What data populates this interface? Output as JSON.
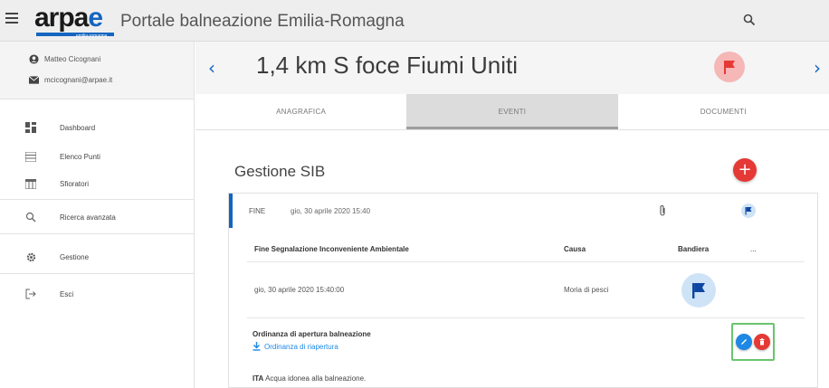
{
  "header": {
    "logo_text": "arpae",
    "logo_sub": "emilia-romagna",
    "portal_title": "Portale balneazione Emilia-Romagna",
    "search_icon": "search-icon",
    "menu_icon": "hamburger-icon"
  },
  "user": {
    "name": "Matteo Cicognani",
    "email": "mcicognani@arpae.it"
  },
  "sidebar": {
    "items": [
      {
        "label": "Dashboard",
        "icon": "dashboard-icon"
      },
      {
        "label": "Elenco Punti",
        "icon": "list-icon"
      },
      {
        "label": "Sfioratori",
        "icon": "calendar-icon"
      },
      {
        "label": "Ricerca avanzata",
        "icon": "search-icon"
      },
      {
        "label": "Gestione",
        "icon": "gear-icon"
      },
      {
        "label": "Esci",
        "icon": "logout-icon"
      }
    ]
  },
  "point": {
    "title": "1,4 km S foce Fiumi Uniti",
    "flag_color": "#e53935"
  },
  "tabs": [
    {
      "label": "ANAGRAFICA",
      "active": false
    },
    {
      "label": "EVENTI",
      "active": true
    },
    {
      "label": "DOCUMENTI",
      "active": false
    }
  ],
  "section": {
    "title": "Gestione SIB",
    "add_label": "+"
  },
  "event": {
    "status": "FINE",
    "datetime": "gio, 30 aprile 2020 15:40",
    "table": {
      "headers": [
        "Fine Segnalazione Inconveniente Ambientale",
        "Causa",
        "Bandiera",
        "..."
      ],
      "row": {
        "date": "gio, 30 aprile 2020 15:40:00",
        "cause": "Moria di pesci"
      }
    },
    "ordinance": {
      "title": "Ordinanza di apertura balneazione",
      "link": "Ordinanza di riapertura"
    },
    "ita": {
      "code": "ITA",
      "text": "Acqua idonea alla balneazione."
    }
  },
  "colors": {
    "accent": "#1565c0",
    "danger": "#e53935",
    "highlight": "#6ac46e"
  }
}
